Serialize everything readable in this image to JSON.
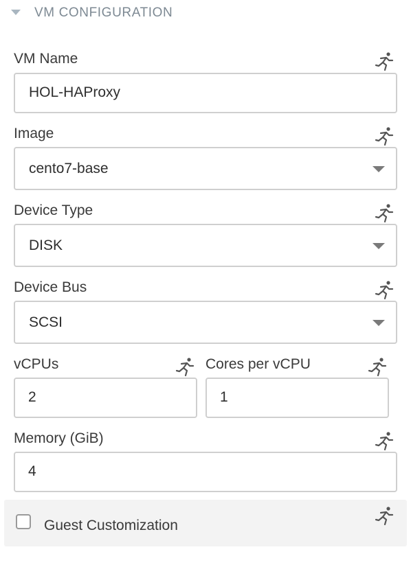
{
  "section": {
    "title": "VM CONFIGURATION"
  },
  "fields": {
    "vm_name": {
      "label": "VM Name",
      "value": "HOL-HAProxy"
    },
    "image": {
      "label": "Image",
      "value": "cento7-base"
    },
    "device_type": {
      "label": "Device Type",
      "value": "DISK"
    },
    "device_bus": {
      "label": "Device Bus",
      "value": "SCSI"
    },
    "vcpus": {
      "label": "vCPUs",
      "value": "2"
    },
    "cores_per_vcpu": {
      "label": "Cores per vCPU",
      "value": "1"
    },
    "memory": {
      "label": "Memory (GiB)",
      "value": "4"
    }
  },
  "guest_customization": {
    "label": "Guest Customization",
    "checked": false
  },
  "icons": {
    "runtime_editable": "running-man-icon",
    "collapse": "caret-down-icon",
    "dropdown": "chevron-down-icon"
  },
  "colors": {
    "section_title": "#7d8993",
    "caret": "#a9b6c0",
    "field_border": "#cfcfcf",
    "panel_bg": "#f3f3f3",
    "runner_icon": "#555555"
  }
}
